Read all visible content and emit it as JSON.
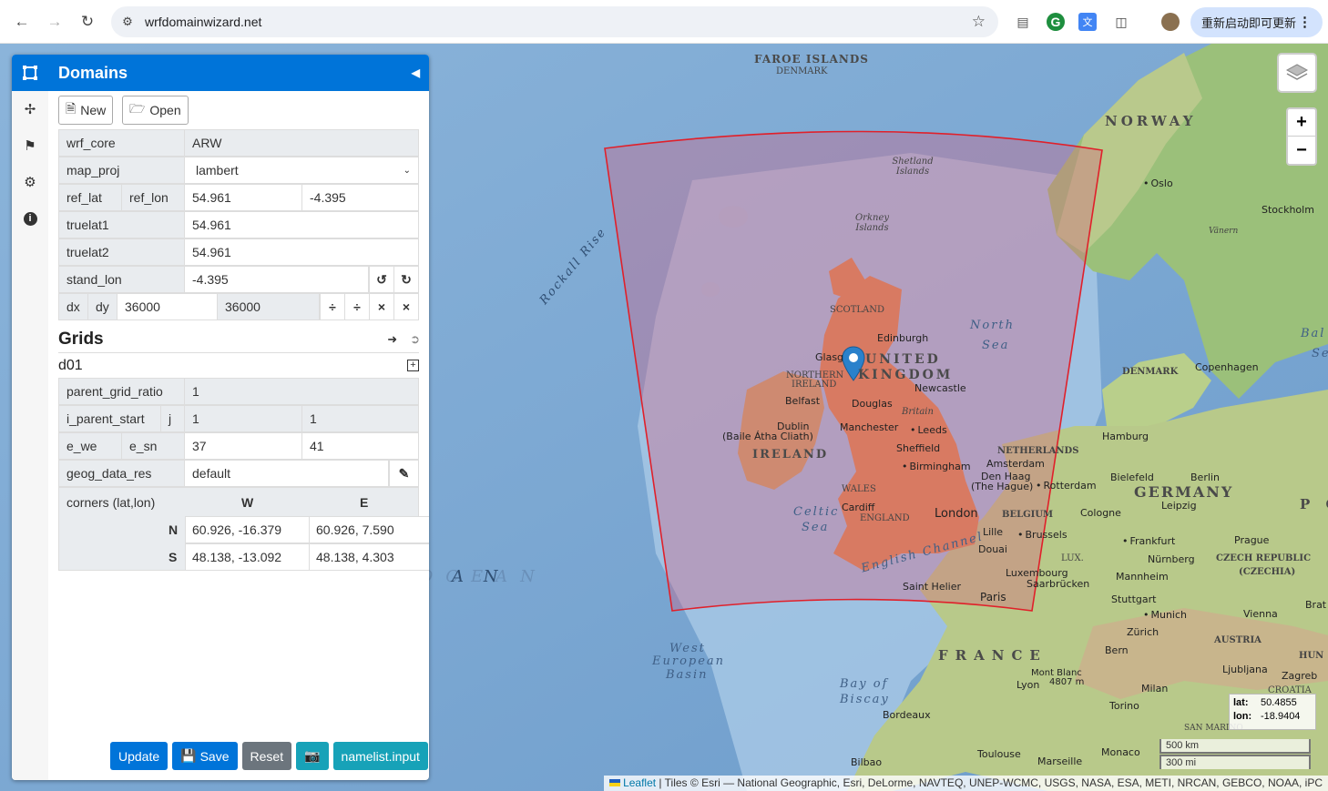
{
  "browser": {
    "back_icon": "back-arrow-icon",
    "forward_icon": "forward-arrow-icon",
    "reload_icon": "reload-icon",
    "url": "wrfdomainwizard.net",
    "update_label": "重新启动即可更新"
  },
  "map": {
    "labels": {
      "faroe": "FAROE ISLANDS",
      "faroe_sub": "DENMARK",
      "norway": "NORWAY",
      "oslo": "Oslo",
      "stockholm": "Stockholm",
      "vanern": "Vänern",
      "shetland": "Shetland Islands",
      "orkney": "Orkney Islands",
      "rockall": "Rockall Rise",
      "scotland": "SCOTLAND",
      "edinburgh": "Edinburgh",
      "glasgow": "Glasg",
      "united": "UNITED",
      "kingdom": "KINGDOM",
      "north_sea_1": "North",
      "north_sea_2": "Sea",
      "northern": "NORTHERN",
      "ireland_n": "IRELAND",
      "newcastle": "Newcastle",
      "belfast": "Belfast",
      "douglas": "Douglas",
      "britain": "Britain",
      "dublin": "Dublin",
      "dublin_sub": "(Baile Átha Cliath)",
      "ireland": "IRELAND",
      "manchester": "Manchester",
      "leeds": "Leeds",
      "sheffield": "Sheffield",
      "birmingham": "Birmingham",
      "wales": "WALES",
      "cardiff": "Cardiff",
      "england": "ENGLAND",
      "london": "London",
      "celtic_1": "Celtic",
      "celtic_2": "Sea",
      "english_channel": "English Channel",
      "denmark": "DENMARK",
      "copenhagen": "Copenhagen",
      "netherlands": "NETHERLANDS",
      "amsterdam": "Amsterdam",
      "den_haag": "Den Haag",
      "den_haag_sub": "(The Hague)",
      "rotterdam": "Rotterdam",
      "hamburg": "Hamburg",
      "bielefeld": "Bielefeld",
      "berlin": "Berlin",
      "germany": "GERMANY",
      "leipzig": "Leipzig",
      "belgium": "BELGIUM",
      "cologne": "Cologne",
      "brussels": "Brussels",
      "lille": "Lille",
      "douai": "Douai",
      "lux": "LUX.",
      "luxembourg": "Luxembourg",
      "saarbrucken": "Saarbrücken",
      "frankfurt": "Frankfurt",
      "prague": "Prague",
      "nurnberg": "Nürnberg",
      "czech": "CZECH REPUBLIC",
      "czechia": "(CZECHIA)",
      "mannheim": "Mannheim",
      "stuttgart": "Stuttgart",
      "munich": "Munich",
      "vienna": "Vienna",
      "saint_helier": "Saint Helier",
      "paris": "Paris",
      "west_euro_1": "West",
      "west_euro_2": "European",
      "west_euro_3": "Basin",
      "france": "FRANCE",
      "zurich": "Zürich",
      "bern": "Bern",
      "austria": "AUSTRIA",
      "mont_blanc": "Mont Blanc",
      "mont_blanc_h": "4807 m",
      "lyon": "Lyon",
      "ljubljana": "Ljubljana",
      "zagreb": "Zagreb",
      "milan": "Milan",
      "biscay_1": "Bay of",
      "biscay_2": "Biscay",
      "bordeaux": "Bordeaux",
      "torino": "Torino",
      "toulouse": "Toulouse",
      "marseille": "Marseille",
      "monaco": "Monaco",
      "bilbao": "Bilbao",
      "north_atlantic": "NORTH ATLANTIC OCEAN",
      "ocean_an": "A N",
      "baltic_1": "Bal",
      "baltic_2": "Se",
      "pc": "P C",
      "brat": "Brat",
      "hun": "HUN",
      "san_marino": "SAN MARINO",
      "croatia": "CROATIA"
    },
    "coords": {
      "lat_label": "lat:",
      "lat": "50.4855",
      "lon_label": "lon:",
      "lon": "-18.9404"
    },
    "scale": {
      "km": "500 km",
      "mi": "300 mi"
    },
    "attribution": {
      "leaflet": "Leaflet",
      "text": " | Tiles © Esri — National Geographic, Esri, DeLorme, NAVTEQ, UNEP-WCMC, USGS, NASA, ESA, METI, NRCAN, GEBCO, NOAA, iPC"
    },
    "zoom_in": "+",
    "zoom_out": "−"
  },
  "sidebar": {
    "title": "Domains",
    "buttons": {
      "new": "New",
      "open": "Open"
    },
    "fields": {
      "wrf_core_label": "wrf_core",
      "wrf_core": "ARW",
      "map_proj_label": "map_proj",
      "map_proj": "lambert",
      "ref_lat_label": "ref_lat",
      "ref_lon_label": "ref_lon",
      "ref_lat": "54.961",
      "ref_lon": "-4.395",
      "truelat1_label": "truelat1",
      "truelat1": "54.961",
      "truelat2_label": "truelat2",
      "truelat2": "54.961",
      "stand_lon_label": "stand_lon",
      "stand_lon": "-4.395",
      "dx_label": "dx",
      "dy_label": "dy",
      "dx": "36000",
      "dy": "36000"
    },
    "grids": {
      "title": "Grids",
      "name": "d01",
      "parent_grid_ratio_label": "parent_grid_ratio",
      "parent_grid_ratio": "1",
      "i_parent_start_label": "i_parent_start",
      "j_label": "j",
      "i_parent_start": "1",
      "j_parent_start": "1",
      "e_we_label": "e_we",
      "e_sn_label": "e_sn",
      "e_we": "37",
      "e_sn": "41",
      "geog_data_res_label": "geog_data_res",
      "geog_data_res": "default",
      "corners_label": "corners (lat,lon)",
      "w_label": "W",
      "e_label": "E",
      "n_label": "N",
      "s_label": "S",
      "nw": "60.926, -16.379",
      "ne": "60.926, 7.590",
      "sw": "48.138, -13.092",
      "se": "48.138, 4.303"
    },
    "actions": {
      "update": "Update",
      "save": "Save",
      "reset": "Reset",
      "namelist": "namelist.input"
    }
  },
  "colors": {
    "primary": "#0074d9",
    "domain_fill": "#d75d7e",
    "domain_stroke": "#e0202a",
    "marker": "#2a81cb"
  }
}
